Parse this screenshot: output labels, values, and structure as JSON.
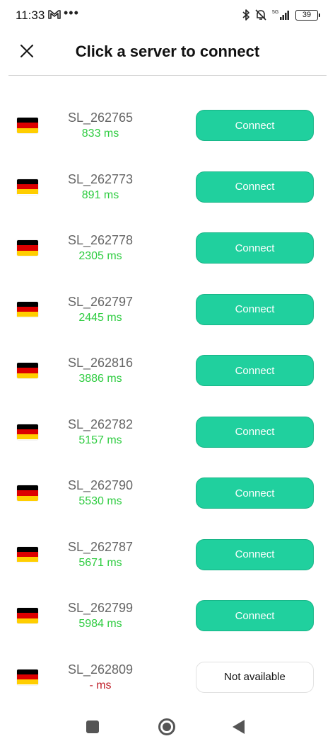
{
  "status_bar": {
    "time": "11:33",
    "dots": "•••",
    "battery": "39",
    "network": "5G"
  },
  "header": {
    "title": "Click a server to connect"
  },
  "colors": {
    "accent": "#20d09e",
    "ping_ok": "#2ecc40",
    "ping_na": "#c0202a",
    "flag_black": "#000000",
    "flag_red": "#dd0000",
    "flag_gold": "#ffce00"
  },
  "servers": [
    {
      "name": "SL_262765",
      "ping": "833 ms",
      "button": "Connect"
    },
    {
      "name": "SL_262773",
      "ping": "891 ms",
      "button": "Connect"
    },
    {
      "name": "SL_262778",
      "ping": "2305 ms",
      "button": "Connect"
    },
    {
      "name": "SL_262797",
      "ping": "2445 ms",
      "button": "Connect"
    },
    {
      "name": "SL_262816",
      "ping": "3886 ms",
      "button": "Connect"
    },
    {
      "name": "SL_262782",
      "ping": "5157 ms",
      "button": "Connect"
    },
    {
      "name": "SL_262790",
      "ping": "5530 ms",
      "button": "Connect"
    },
    {
      "name": "SL_262787",
      "ping": "5671 ms",
      "button": "Connect"
    },
    {
      "name": "SL_262799",
      "ping": "5984 ms",
      "button": "Connect"
    },
    {
      "name": "SL_262809",
      "ping": "- ms",
      "button": "Not available"
    }
  ],
  "icons": {
    "close": "close-icon",
    "flag": "germany-flag-icon",
    "nav_recent": "square-icon",
    "nav_home": "circle-icon",
    "nav_back": "triangle-back-icon"
  }
}
